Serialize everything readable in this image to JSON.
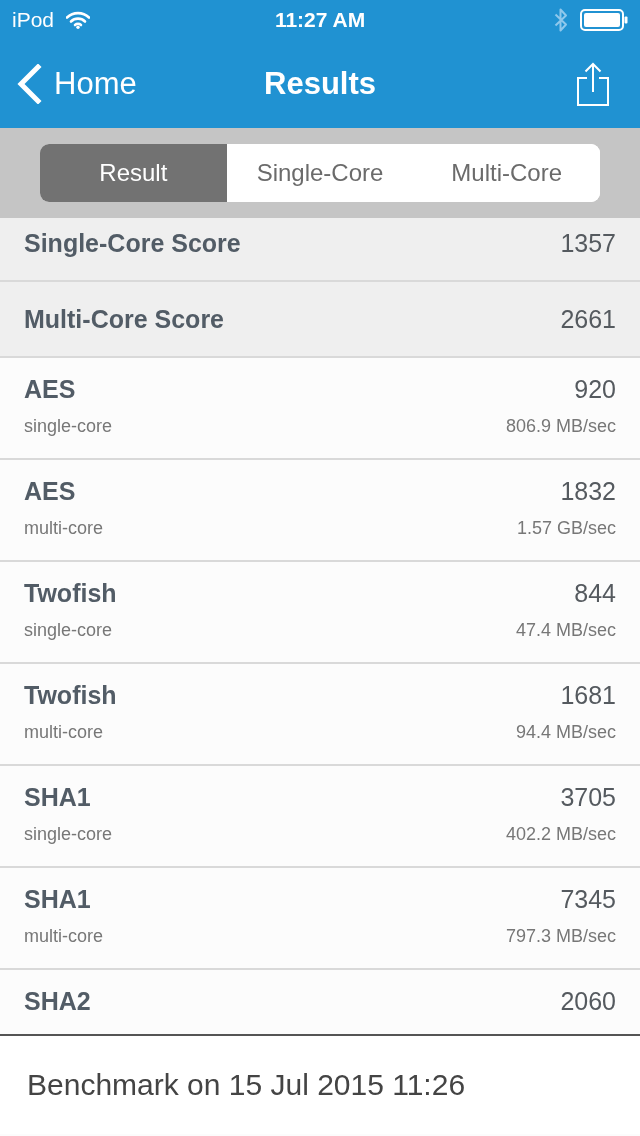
{
  "status_bar": {
    "carrier": "iPod",
    "time": "11:27 AM"
  },
  "nav_bar": {
    "back_label": "Home",
    "title": "Results"
  },
  "segments": [
    {
      "label": "Result",
      "selected": true
    },
    {
      "label": "Single-Core",
      "selected": false
    },
    {
      "label": "Multi-Core",
      "selected": false
    }
  ],
  "rows": [
    {
      "kind": "score",
      "label": "Single-Core Score",
      "value": "1357"
    },
    {
      "kind": "score",
      "label": "Multi-Core Score",
      "value": "2661"
    },
    {
      "kind": "test",
      "name": "AES",
      "mode": "single-core",
      "score": "920",
      "rate": "806.9 MB/sec"
    },
    {
      "kind": "test",
      "name": "AES",
      "mode": "multi-core",
      "score": "1832",
      "rate": "1.57 GB/sec"
    },
    {
      "kind": "test",
      "name": "Twofish",
      "mode": "single-core",
      "score": "844",
      "rate": "47.4 MB/sec"
    },
    {
      "kind": "test",
      "name": "Twofish",
      "mode": "multi-core",
      "score": "1681",
      "rate": "94.4 MB/sec"
    },
    {
      "kind": "test",
      "name": "SHA1",
      "mode": "single-core",
      "score": "3705",
      "rate": "402.2 MB/sec"
    },
    {
      "kind": "test",
      "name": "SHA1",
      "mode": "multi-core",
      "score": "7345",
      "rate": "797.3 MB/sec"
    },
    {
      "kind": "test",
      "name": "SHA2",
      "score": "2060"
    }
  ],
  "footer": {
    "text": "Benchmark on 15 Jul 2015 11:26"
  }
}
